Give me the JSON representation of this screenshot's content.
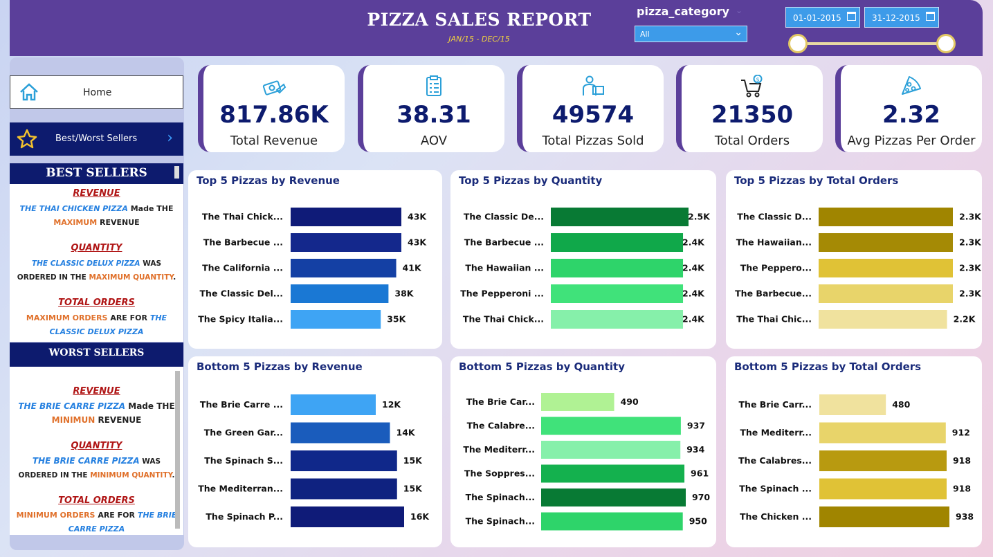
{
  "header": {
    "title": "PIZZA SALES REPORT",
    "subtitle": "JAN/15 - DEC/15",
    "filter_label": "pizza_category",
    "filter_value": "All",
    "date_start": "01-01-2015",
    "date_end": "31-12-2015"
  },
  "nav": {
    "home": "Home",
    "best_worst": "Best/Worst Sellers"
  },
  "best_sellers": {
    "heading": "BEST SELLERS",
    "revenue_h": "REVENUE",
    "revenue_pizza": "THE THAI CHICKEN PIZZA",
    "revenue_mid": "Made THE",
    "revenue_kw": "MAXIMUM",
    "revenue_end": "REVENUE",
    "quantity_h": "QUANTITY",
    "quantity_pizza": "THE CLASSIC DELUX PIZZA",
    "quantity_mid": "WAS ORDERED IN THE",
    "quantity_kw": "MAXIMUM QUANTITY",
    "quantity_end": ".",
    "orders_h": "TOTAL ORDERS",
    "orders_kw": "MAXIMUM ORDERS",
    "orders_mid": "ARE FOR",
    "orders_pizza": "THE CLASSIC DELUX PIZZA"
  },
  "worst_sellers": {
    "heading": "WORST SELLERS",
    "revenue_h": "REVENUE",
    "revenue_pizza": "THE BRIE CARRE PIZZA",
    "revenue_mid": "Made THE",
    "revenue_kw": "MINIMUN",
    "revenue_end": "REVENUE",
    "quantity_h": "QUANTITY",
    "quantity_pizza": "THE BRIE CARRE PIZZA",
    "quantity_mid": "WAS ORDERED IN THE",
    "quantity_kw": "MINIMUM QUANTITY",
    "quantity_end": ".",
    "orders_h": "TOTAL ORDERS",
    "orders_kw": "MINIMUM ORDERS",
    "orders_mid": "ARE FOR",
    "orders_pizza": "THE BRIE CARRE PIZZA"
  },
  "kpis": [
    {
      "value": "817.86K",
      "label": "Total Revenue",
      "icon": "money-icon"
    },
    {
      "value": "38.31",
      "label": "AOV",
      "icon": "clipboard-icon"
    },
    {
      "value": "49574",
      "label": "Total Pizzas Sold",
      "icon": "delivery-icon"
    },
    {
      "value": "21350",
      "label": "Total Orders",
      "icon": "cart-icon"
    },
    {
      "value": "2.32",
      "label": "Avg Pizzas Per Order",
      "icon": "pizza-icon"
    }
  ],
  "chart_data": [
    {
      "type": "bar",
      "title": "Top 5 Pizzas by Revenue",
      "categories": [
        "The Thai Chick...",
        "The Barbecue ...",
        "The California ...",
        "The Classic Del...",
        "The Spicy Italia..."
      ],
      "values": [
        43000,
        43000,
        41000,
        38000,
        35000
      ],
      "labels": [
        "43K",
        "43K",
        "41K",
        "38K",
        "35K"
      ],
      "colors": [
        "#0f1b78",
        "#14288c",
        "#1440a4",
        "#1a78d4",
        "#3ea4f4"
      ]
    },
    {
      "type": "bar",
      "title": "Top 5 Pizzas by Quantity",
      "categories": [
        "The Classic De...",
        "The Barbecue ...",
        "The Hawaiian ...",
        "The Pepperoni ...",
        "The Thai Chick..."
      ],
      "values": [
        2500,
        2400,
        2400,
        2400,
        2400
      ],
      "labels": [
        "2.5K",
        "2.4K",
        "2.4K",
        "2.4K",
        "2.4K"
      ],
      "colors": [
        "#087a34",
        "#10a84a",
        "#2ed46a",
        "#40e27a",
        "#86f0aa"
      ]
    },
    {
      "type": "bar",
      "title": "Top 5 Pizzas by Total Orders",
      "categories": [
        "The Classic D...",
        "The Hawaiian...",
        "The Peppero...",
        "The Barbecue...",
        "The Thai Chic..."
      ],
      "values": [
        2300,
        2300,
        2300,
        2300,
        2200
      ],
      "labels": [
        "2.3K",
        "2.3K",
        "2.3K",
        "2.3K",
        "2.2K"
      ],
      "colors": [
        "#a08500",
        "#a58a05",
        "#e0c236",
        "#e8d46a",
        "#f0e29e"
      ]
    },
    {
      "type": "bar",
      "title": "Bottom 5 Pizzas by Revenue",
      "categories": [
        "The Brie Carre ...",
        "The Green Gar...",
        "The Spinach S...",
        "The Mediterran...",
        "The Spinach P..."
      ],
      "values": [
        12000,
        14000,
        15000,
        15000,
        16000
      ],
      "labels": [
        "12K",
        "14K",
        "15K",
        "15K",
        "16K"
      ],
      "colors": [
        "#3ea4f4",
        "#1a5cbc",
        "#10288a",
        "#0f2280",
        "#0f1b78"
      ]
    },
    {
      "type": "bar",
      "title": "Bottom 5 Pizzas by Quantity",
      "categories": [
        "The Brie Car...",
        "The Calabre...",
        "The Mediterr...",
        "The Soppres...",
        "The Spinach...",
        "The Spinach..."
      ],
      "values": [
        490,
        937,
        934,
        961,
        970,
        950
      ],
      "labels": [
        "490",
        "937",
        "934",
        "961",
        "970",
        "950"
      ],
      "colors": [
        "#b0f294",
        "#40e27a",
        "#86f0aa",
        "#14b14e",
        "#087a34",
        "#2ed46a"
      ]
    },
    {
      "type": "bar",
      "title": "Bottom 5 Pizzas by Total Orders",
      "categories": [
        "The Brie Carr...",
        "The Mediterr...",
        "The Calabres...",
        "The Spinach ...",
        "The Chicken ..."
      ],
      "values": [
        480,
        912,
        918,
        918,
        938
      ],
      "labels": [
        "480",
        "912",
        "918",
        "918",
        "938"
      ],
      "colors": [
        "#f0e29e",
        "#e8d46a",
        "#b89a10",
        "#e0c236",
        "#a08500"
      ]
    }
  ]
}
